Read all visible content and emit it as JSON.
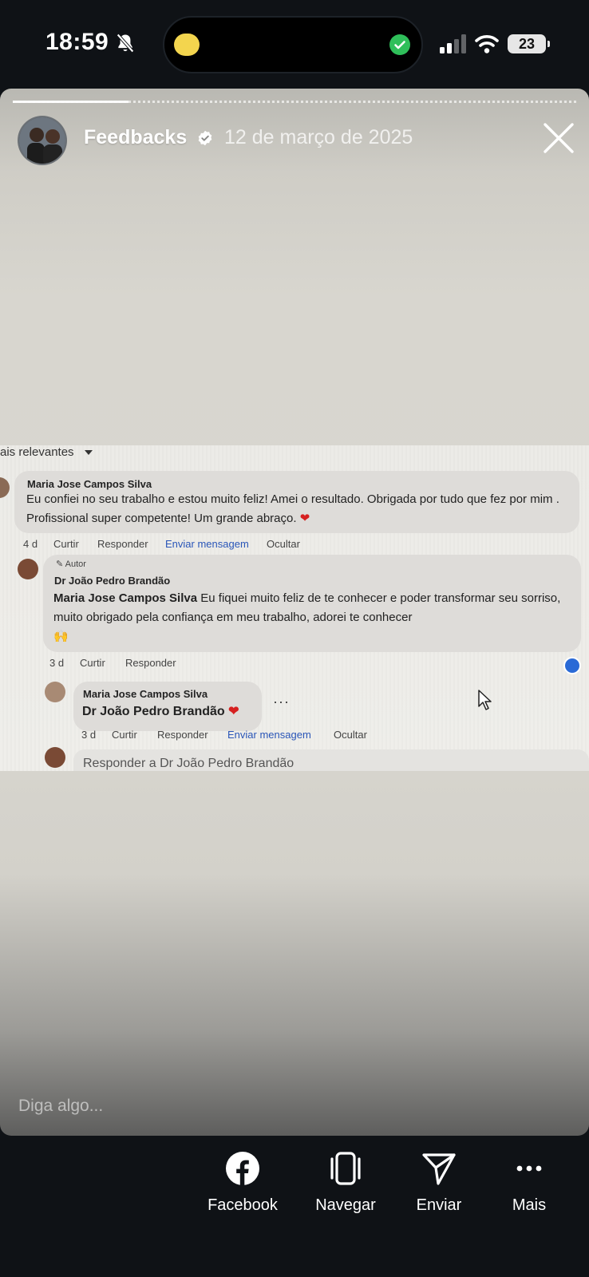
{
  "status_bar": {
    "time": "18:59",
    "battery": "23"
  },
  "story": {
    "author": "Feedbacks",
    "date": "12 de março de 2025",
    "input_placeholder": "Diga algo..."
  },
  "photo_content": {
    "sort_label": "ais relevantes",
    "comment1": {
      "name": "Maria Jose Campos Silva",
      "text": "Eu confiei no seu trabalho e estou muito feliz! Amei o resultado. Obrigada por tudo que fez por mim . Profissional super competente! Um grande abraço.",
      "time": "4 d",
      "actions": [
        "Curtir",
        "Responder",
        "Enviar mensagem",
        "Ocultar"
      ]
    },
    "reply1": {
      "badge": "Autor",
      "name": "Dr João Pedro Brandão",
      "mention": "Maria Jose Campos Silva",
      "text": "Eu fiquei muito feliz de te conhecer e poder transformar seu sorriso, muito obrigado pela confiança em meu trabalho, adorei te conhecer",
      "emoji": "🙌",
      "time": "3 d",
      "actions": [
        "Curtir",
        "Responder"
      ]
    },
    "reply2": {
      "name": "Maria Jose Campos Silva",
      "text": "Dr João Pedro Brandão",
      "time": "3 d",
      "actions": [
        "Curtir",
        "Responder",
        "Enviar mensagem",
        "Ocultar"
      ]
    },
    "reply_placeholder": "Responder a Dr João Pedro Brandão"
  },
  "actions": [
    {
      "label": "Facebook",
      "icon": "facebook-icon"
    },
    {
      "label": "Navegar",
      "icon": "browse-icon"
    },
    {
      "label": "Enviar",
      "icon": "send-icon"
    },
    {
      "label": "Mais",
      "icon": "more-icon"
    }
  ],
  "colors": {
    "background": "#0f1216",
    "link_blue": "#2a56b8",
    "verified_badge": "#ffffff",
    "heart": "#d62020"
  }
}
